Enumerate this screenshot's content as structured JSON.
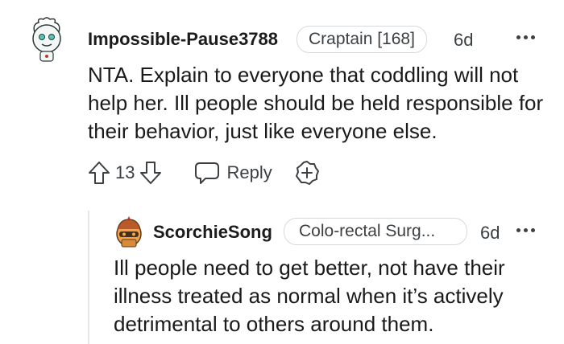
{
  "comment": {
    "username": "Impossible-Pause3788",
    "flair": "Craptain [168]",
    "timestamp": "6d",
    "body": "NTA. Explain to everyone that coddling will not help her. Ill people should be held responsible for their behavior, just like everyone else.",
    "vote_count": "13",
    "reply_label": "Reply",
    "avatar_icon": "snoo-avatar-icon"
  },
  "reply": {
    "username": "ScorchieSong",
    "flair": "Colo-rectal Surg...",
    "timestamp": "6d",
    "body": "Ill people need to get better, not have their illness treated as normal when it’s actively detrimental to others around them.",
    "avatar_icon": "snoo-avatar-icon"
  },
  "colors": {
    "text": "#1a1a1b",
    "muted": "#3c4043",
    "border": "#d7d9dc",
    "thread_line": "#e5e7ea"
  }
}
